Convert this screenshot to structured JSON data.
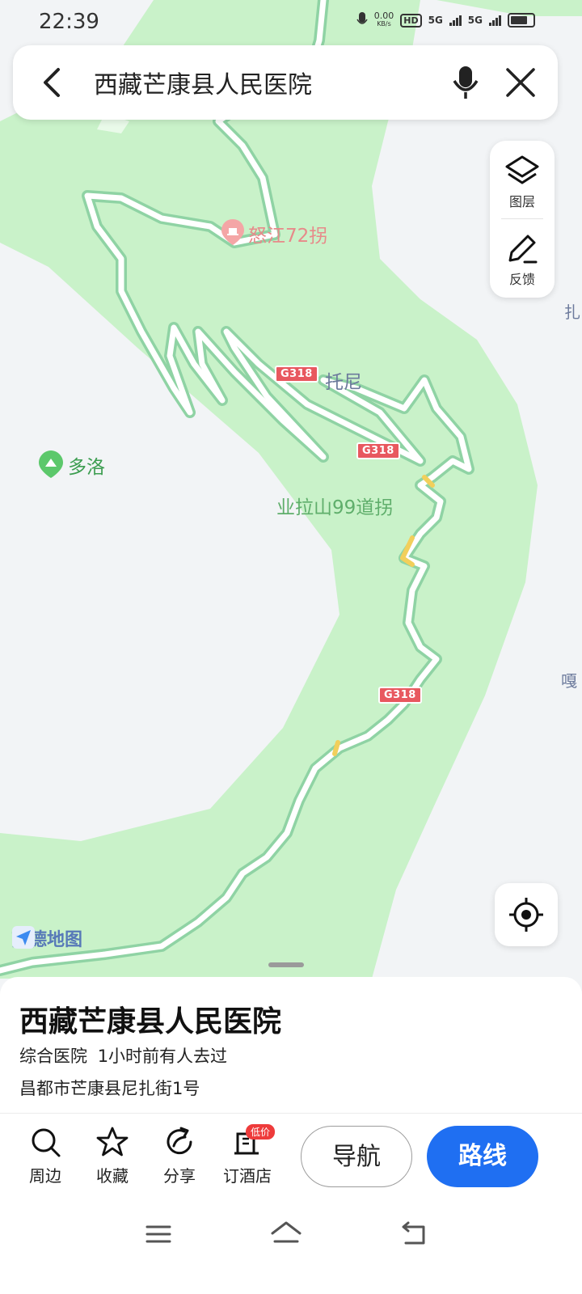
{
  "status_bar": {
    "time": "22:39",
    "net_speed_value": "0.00",
    "net_speed_unit": "KB/s",
    "hd_label": "HD",
    "sim1_label": "5G",
    "sim2_label": "5G"
  },
  "search_bar": {
    "query": "西藏芒康县人民医院",
    "back_icon": "chevron-left-icon",
    "mic_icon": "microphone-icon",
    "close_icon": "close-icon"
  },
  "map_tools": {
    "layers_label": "图层",
    "feedback_label": "反馈"
  },
  "map": {
    "labels": {
      "nujiang": "怒江72拐",
      "tuoni": "托尼",
      "duoluo": "多洛",
      "yelashan": "业拉山99道拐"
    },
    "road_badges": [
      "G318",
      "G318",
      "G318"
    ],
    "edge_labels": [
      "扎",
      "嘎"
    ],
    "logo_text": "高德地图"
  },
  "poi_sheet": {
    "name": "西藏芒康县人民医院",
    "category": "综合医院",
    "visit_note": "1小时前有人去过",
    "address": "昌都市芒康县尼扎街1号"
  },
  "actions": {
    "nearby": "周边",
    "favorite": "收藏",
    "share": "分享",
    "hotel": "订酒店",
    "hotel_badge": "低价",
    "navigate": "导航",
    "route": "路线"
  },
  "colors": {
    "map_background": "#f2f4f6",
    "terrain_green": "#c9f2c9",
    "road_outline": "#8fd3a4",
    "road_fill": "#ffffff",
    "road_badge": "#e8585f",
    "route_button": "#1f6ff2"
  }
}
